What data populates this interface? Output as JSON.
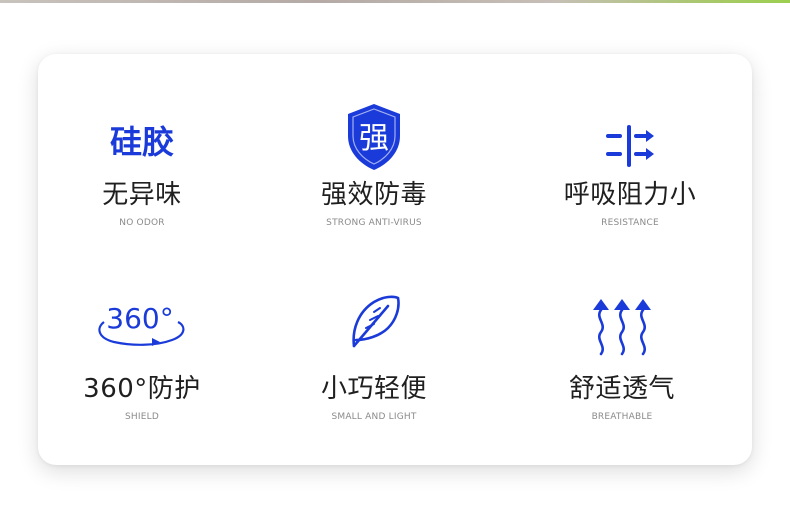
{
  "accent_color": "#1a3bd9",
  "features": [
    {
      "icon": "silicone-text-icon",
      "icon_label": "硅胶",
      "title": "无异味",
      "subtitle": "NO ODOR"
    },
    {
      "icon": "shield-icon",
      "icon_label": "强",
      "title": "强效防毒",
      "subtitle": "STRONG ANTI-VIRUS"
    },
    {
      "icon": "airflow-arrows-icon",
      "title": "呼吸阻力小",
      "subtitle": "RESISTANCE"
    },
    {
      "icon": "rotate-360-icon",
      "icon_label": "360°",
      "title": "360°防护",
      "subtitle": "SHIELD"
    },
    {
      "icon": "feather-icon",
      "title": "小巧轻便",
      "subtitle": "SMALL AND LIGHT"
    },
    {
      "icon": "breathable-wave-icon",
      "title": "舒适透气",
      "subtitle": "BREATHABLE"
    }
  ]
}
